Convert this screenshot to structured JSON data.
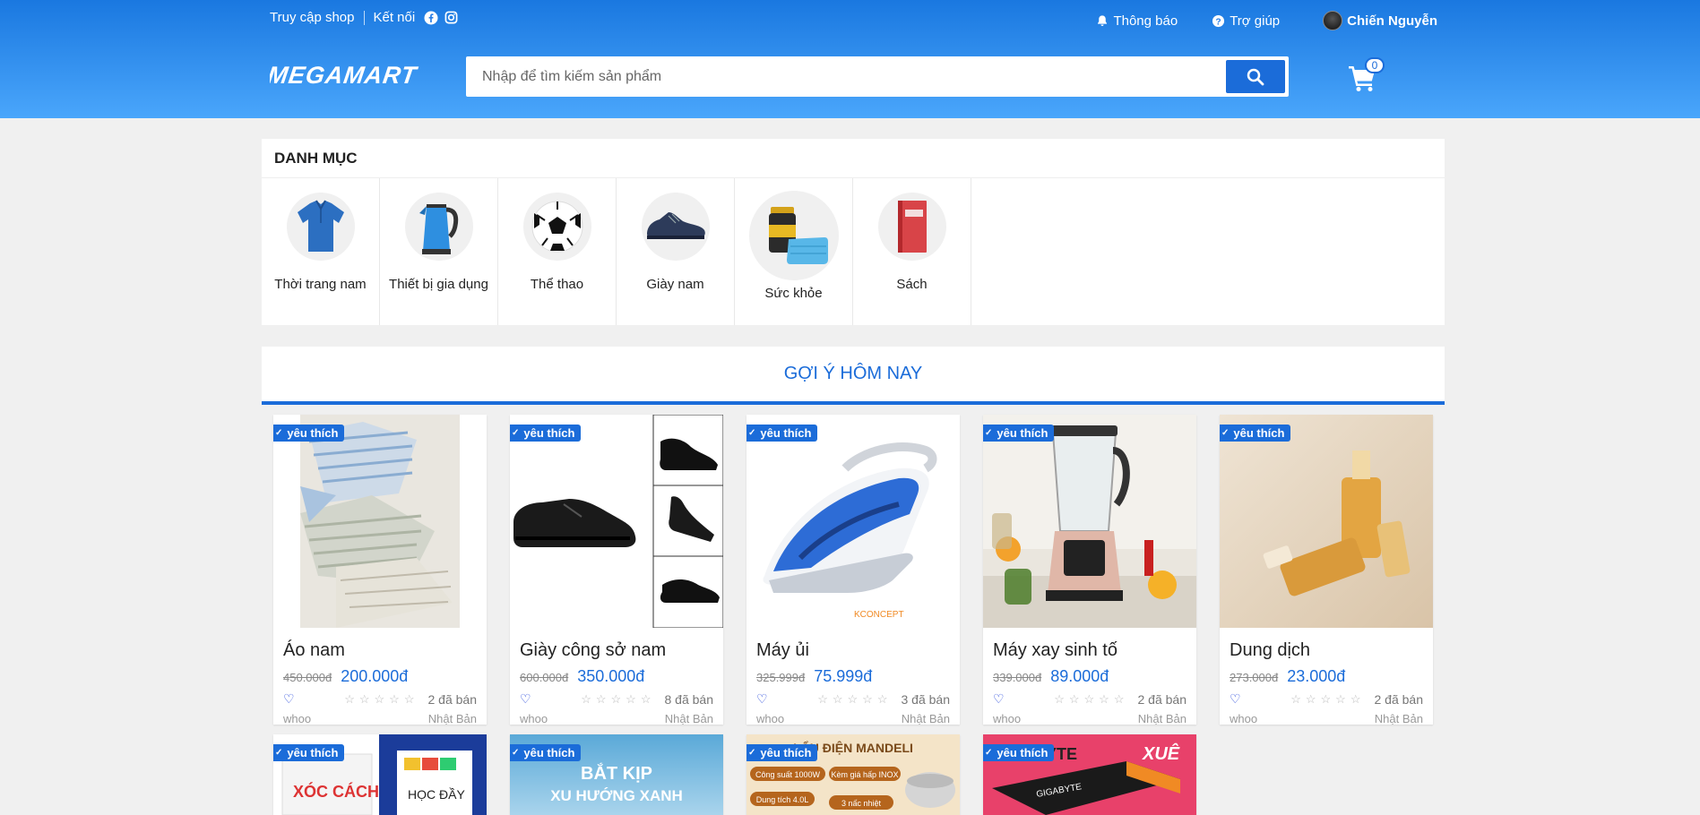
{
  "topbar": {
    "visit_shop": "Truy cập shop",
    "connect": "Kết nối",
    "notifications": "Thông báo",
    "help": "Trợ giúp",
    "user_name": "Chiến Nguyễn"
  },
  "brand": {
    "logo": "MEGAMART",
    "accent": "#1b6cd9"
  },
  "search": {
    "placeholder": "Nhập để tìm kiếm sản phẩm",
    "value": ""
  },
  "cart": {
    "count": "0"
  },
  "categories": {
    "title": "DANH MỤC",
    "items": [
      {
        "label": "Thời trang nam",
        "icon": "shirt-icon"
      },
      {
        "label": "Thiết bị gia dụng",
        "icon": "kettle-icon"
      },
      {
        "label": "Thể thao",
        "icon": "soccer-ball-icon"
      },
      {
        "label": "Giày nam",
        "icon": "shoe-icon"
      },
      {
        "label": "Sức khỏe",
        "icon": "health-icon"
      },
      {
        "label": "Sách",
        "icon": "book-icon"
      }
    ]
  },
  "suggestions": {
    "title": "GỢI Ý HÔM NAY",
    "badge": "yêu thích",
    "products": [
      {
        "name": "Áo nam",
        "old_price": "450.000đ",
        "price": "200.000đ",
        "sold": "2 đã bán",
        "shop": "whoo",
        "origin": "Nhật Bản"
      },
      {
        "name": "Giày công sở nam",
        "old_price": "600.000đ",
        "price": "350.000đ",
        "sold": "8 đã bán",
        "shop": "whoo",
        "origin": "Nhật Bản"
      },
      {
        "name": "Máy ủi",
        "old_price": "325.999đ",
        "price": "75.999đ",
        "sold": "3 đã bán",
        "shop": "whoo",
        "origin": "Nhật Bản"
      },
      {
        "name": "Máy xay sinh tố",
        "old_price": "339.000đ",
        "price": "89.000đ",
        "sold": "2 đã bán",
        "shop": "whoo",
        "origin": "Nhật Bản"
      },
      {
        "name": "Dung dịch",
        "old_price": "273.000đ",
        "price": "23.000đ",
        "sold": "2 đã bán",
        "shop": "whoo",
        "origin": "Nhật Bản"
      }
    ],
    "row2_texts": {
      "p6_label": "HỌC ĐẦY",
      "p6_label2": "XÓC CÁCH",
      "p7_line1": "BẮT KỊP",
      "p7_line2": "XU HƯỚNG XANH",
      "p8_title": "LẨU ĐIỆN MANDELI",
      "p8_power": "Công suất 1000W",
      "p8_steam": "Kèm giá hấp INOX",
      "p8_volume": "Dung tích 4.0L",
      "p8_levels": "3 nấc nhiệt",
      "p9_brand": "XUÊ",
      "p9_brand2": "GIGABYTE",
      "p9_brand3": "YTE"
    }
  }
}
